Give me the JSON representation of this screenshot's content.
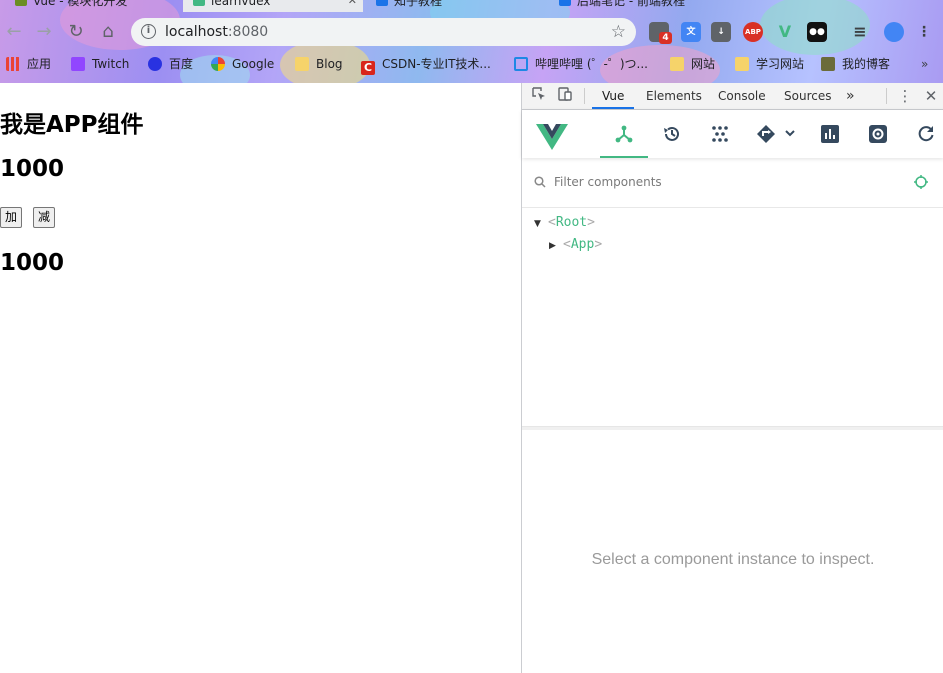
{
  "browser": {
    "tabs": [
      {
        "label": "Vue - 模块化开发"
      },
      {
        "label": "learnvuex"
      },
      {
        "label": "知乎教程"
      },
      {
        "label": "后端笔记 - 前端教程"
      }
    ],
    "url": {
      "host": "localhost",
      "port": ":8080"
    },
    "extension_badge": "4",
    "abp_label": "ABP",
    "bookmarks": [
      {
        "label": "应用"
      },
      {
        "label": "Twitch"
      },
      {
        "label": "百度"
      },
      {
        "label": "Google"
      },
      {
        "label": "Blog"
      },
      {
        "label": "CSDN-专业IT技术..."
      },
      {
        "label": "哔哩哔哩 (゜-゜)つ..."
      },
      {
        "label": "网站"
      },
      {
        "label": "学习网站"
      },
      {
        "label": "我的博客"
      }
    ],
    "bookmarks_more": "»"
  },
  "page": {
    "heading": "我是APP组件",
    "counter_top": "1000",
    "add_label": "加",
    "sub_label": "减",
    "counter_bottom": "1000"
  },
  "devtools": {
    "tabs": [
      {
        "label": "Vue"
      },
      {
        "label": "Elements"
      },
      {
        "label": "Console"
      },
      {
        "label": "Sources"
      }
    ],
    "more_tabs": "»",
    "filter_placeholder": "Filter components",
    "tree": [
      {
        "open": "<",
        "name": "Root",
        "close": ">"
      },
      {
        "open": "<",
        "name": "App",
        "close": ">"
      }
    ],
    "inspect_message": "Select a component instance to inspect."
  },
  "colors": {
    "vue_green": "#42b883",
    "vue_dark": "#35495e",
    "devtools_tab_accent": "#1a73e8"
  }
}
